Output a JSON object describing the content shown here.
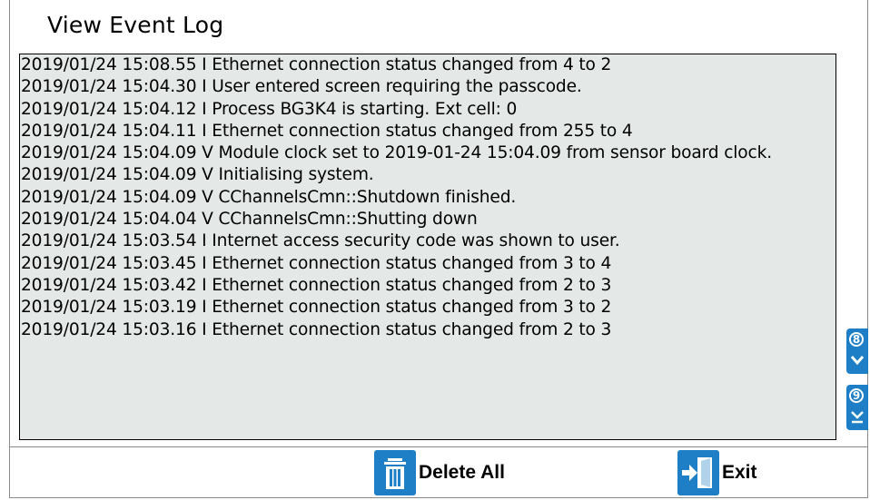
{
  "window": {
    "title": "View Event Log"
  },
  "log": {
    "entries": [
      "2019/01/24 15:08.55 I Ethernet connection status changed from 4 to 2",
      "2019/01/24 15:04.30 I User entered screen requiring the passcode.",
      "2019/01/24 15:04.12 I Process BG3K4 is starting. Ext cell: 0",
      "2019/01/24 15:04.11 I Ethernet connection status changed from 255 to 4",
      "2019/01/24 15:04.09 V Module clock set to 2019-01-24 15:04.09 from sensor board clock.",
      "2019/01/24 15:04.09 V Initialising system.",
      "2019/01/24 15:04.09 V CChannelsCmn::Shutdown finished.",
      "2019/01/24 15:04.04 V CChannelsCmn::Shutting down",
      "2019/01/24 15:03.54 I Internet access security code was shown to user.",
      "2019/01/24 15:03.45 I Ethernet connection status changed from 3 to 4",
      "2019/01/24 15:03.42 I Ethernet connection status changed from 2 to 3",
      "2019/01/24 15:03.19 I Ethernet connection status changed from 3 to 2",
      "2019/01/24 15:03.16 I Ethernet connection status changed from 2 to 3"
    ]
  },
  "scroll": {
    "down": {
      "key": "8",
      "icon": "chevron-down-icon"
    },
    "end": {
      "key": "9",
      "icon": "double-chevron-down-icon"
    }
  },
  "actions": {
    "delete_all_label": "Delete All",
    "exit_label": "Exit"
  },
  "colors": {
    "accent": "#1e7fc6",
    "log_background": "#e4e8e6"
  }
}
